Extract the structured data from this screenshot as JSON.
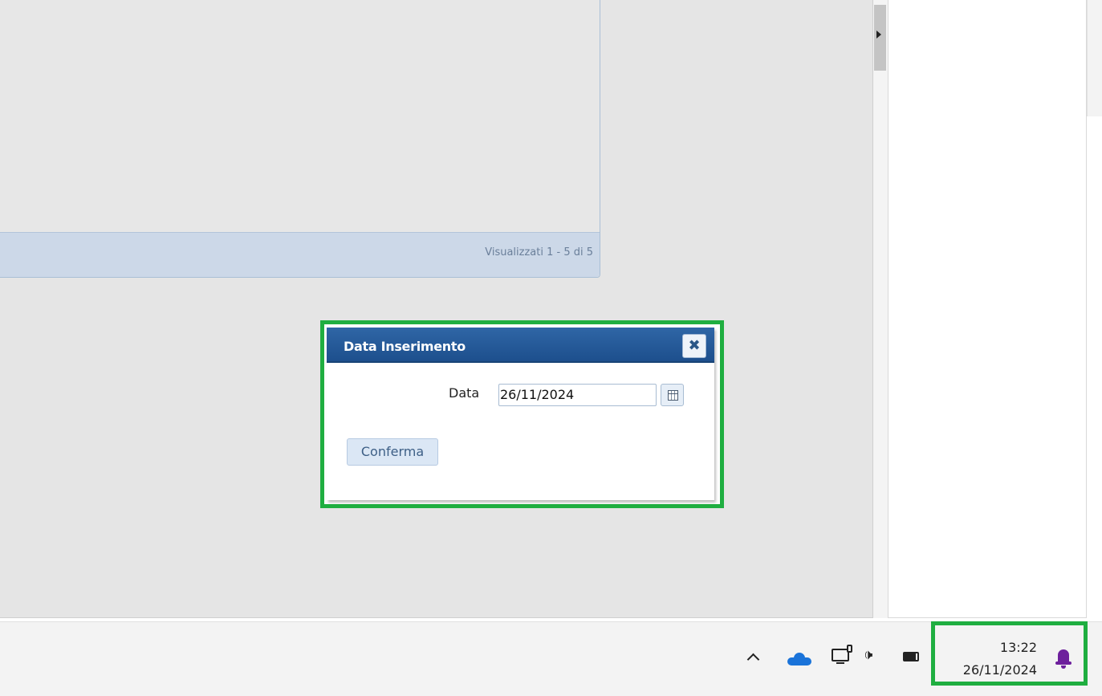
{
  "grid": {
    "pager_text": "Visualizzati 1 - 5 di 5"
  },
  "dialog": {
    "title": "Data Inserimento",
    "close_label": "✖",
    "date_label": "Data",
    "date_value": "26/11/2024",
    "confirm_label": "Conferma"
  },
  "taskbar": {
    "time": "13:22",
    "date": "26/11/2024",
    "tray_icons": [
      "chevron-up-icon",
      "onedrive-cloud-icon",
      "network-icon",
      "volume-icon",
      "battery-icon",
      "notification-bell-icon"
    ]
  },
  "colors": {
    "dialog_title_bg": "#1d4f8d",
    "highlight_frame": "#1fae40",
    "notification_bell": "#6d1f9c",
    "onedrive": "#1a73d9"
  }
}
